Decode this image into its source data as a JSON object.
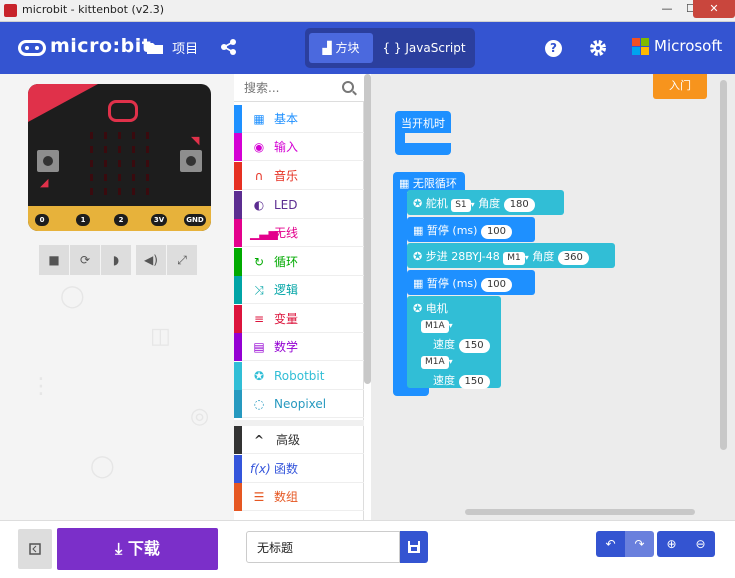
{
  "window": {
    "title": "microbit - kittenbot (v2.3)",
    "minimize": "—",
    "maximize": "☐",
    "close": "✕"
  },
  "header": {
    "logo": "micro:bit",
    "projects_label": "项目",
    "blocks_label": "方块",
    "javascript_label": "JavaScript",
    "brand": "Microsoft",
    "colors": {
      "header": "#3454d1",
      "toggle": "#2b3f9e"
    }
  },
  "simulator": {
    "pin_labels": [
      "0",
      "1",
      "2",
      "3V",
      "GND"
    ],
    "controls": [
      "stop-icon",
      "restart-icon",
      "slowmo-icon",
      "sound-icon",
      "fullscreen-icon"
    ]
  },
  "palette": {
    "search_placeholder": "搜索...",
    "categories": [
      {
        "label": "基本",
        "color": "#1e90ff",
        "icon": "grid-icon"
      },
      {
        "label": "输入",
        "color": "#d400d4",
        "icon": "target-icon"
      },
      {
        "label": "音乐",
        "color": "#e63022",
        "icon": "headphones-icon"
      },
      {
        "label": "LED",
        "color": "#5c2d91",
        "icon": "toggle-icon"
      },
      {
        "label": "无线",
        "color": "#e3008c",
        "icon": "signal-icon"
      },
      {
        "label": "循环",
        "color": "#00aa00",
        "icon": "refresh-icon"
      },
      {
        "label": "逻辑",
        "color": "#00a4a6",
        "icon": "shuffle-icon"
      },
      {
        "label": "变量",
        "color": "#dc143c",
        "icon": "list-icon"
      },
      {
        "label": "数学",
        "color": "#9400d3",
        "icon": "calculator-icon"
      },
      {
        "label": "Robotbit",
        "color": "#31bed6",
        "icon": "rebel-icon"
      },
      {
        "label": "Neopixel",
        "color": "#2699bf",
        "icon": "ring-icon"
      }
    ],
    "advanced": [
      {
        "label": "高级",
        "color": "#333333",
        "icon": "chevron-up-icon"
      },
      {
        "label": "函数",
        "color": "#3455db",
        "icon": "function-icon"
      },
      {
        "label": "数组",
        "color": "#e65722",
        "icon": "array-icon"
      }
    ]
  },
  "workspace": {
    "tutorial_label": "入门",
    "on_start": "当开机时",
    "forever": "无限循环",
    "blocks": {
      "servo": {
        "label": "舵机",
        "servo": "S1",
        "angle_label": "角度",
        "angle": "180"
      },
      "pause1": {
        "label": "暂停 (ms)",
        "value": "100"
      },
      "stepper": {
        "label": "步进 28BYJ-48",
        "motor": "M1",
        "angle_label": "角度",
        "angle": "360"
      },
      "pause2": {
        "label": "暂停 (ms)",
        "value": "100"
      },
      "motor": {
        "label": "电机",
        "m1": "M1A",
        "speed_label": "速度",
        "speed1": "150",
        "m2": "M1A",
        "speed2": "150"
      }
    }
  },
  "bottom": {
    "download_label": "下载",
    "project_name": "无标题"
  }
}
